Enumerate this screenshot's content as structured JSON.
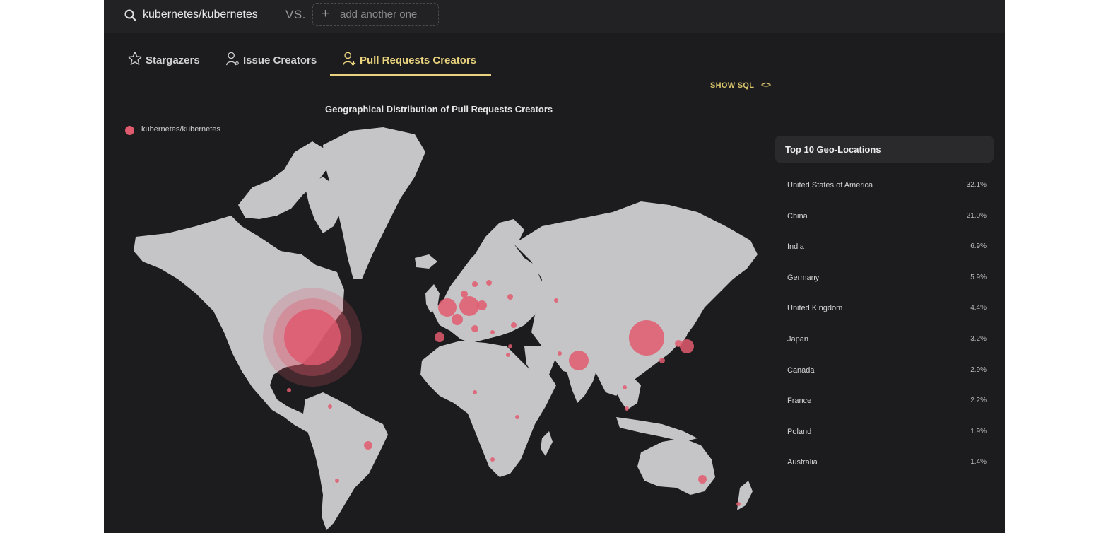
{
  "search": {
    "repo": "kubernetes/kubernetes",
    "vs_label": "VS.",
    "add_placeholder": "add another one"
  },
  "tabs": [
    {
      "label": "Stargazers",
      "icon": "star-icon",
      "active": false
    },
    {
      "label": "Issue Creators",
      "icon": "user-icon",
      "active": false
    },
    {
      "label": "Pull Requests Creators",
      "icon": "user-plus-icon",
      "active": true
    }
  ],
  "show_sql": {
    "label": "SHOW SQL",
    "code_icon": "<>"
  },
  "chart_title": "Geographical Distribution of Pull Requests Creators",
  "legend": {
    "label": "kubernetes/kubernetes",
    "color": "#e05a6e"
  },
  "top_locations": {
    "title": "Top 10 Geo-Locations",
    "items": [
      {
        "name": "United States of America",
        "pct": "32.1%"
      },
      {
        "name": "China",
        "pct": "21.0%"
      },
      {
        "name": "India",
        "pct": "6.9%"
      },
      {
        "name": "Germany",
        "pct": "5.9%"
      },
      {
        "name": "United Kingdom",
        "pct": "4.4%"
      },
      {
        "name": "Japan",
        "pct": "3.2%"
      },
      {
        "name": "Canada",
        "pct": "2.9%"
      },
      {
        "name": "France",
        "pct": "2.2%"
      },
      {
        "name": "Poland",
        "pct": "1.9%"
      },
      {
        "name": "Australia",
        "pct": "1.4%"
      }
    ]
  },
  "colors": {
    "accent": "#e8d27e",
    "bubble": "#e05a6e",
    "land": "#c5c5c8",
    "background": "#1c1c1e"
  }
}
